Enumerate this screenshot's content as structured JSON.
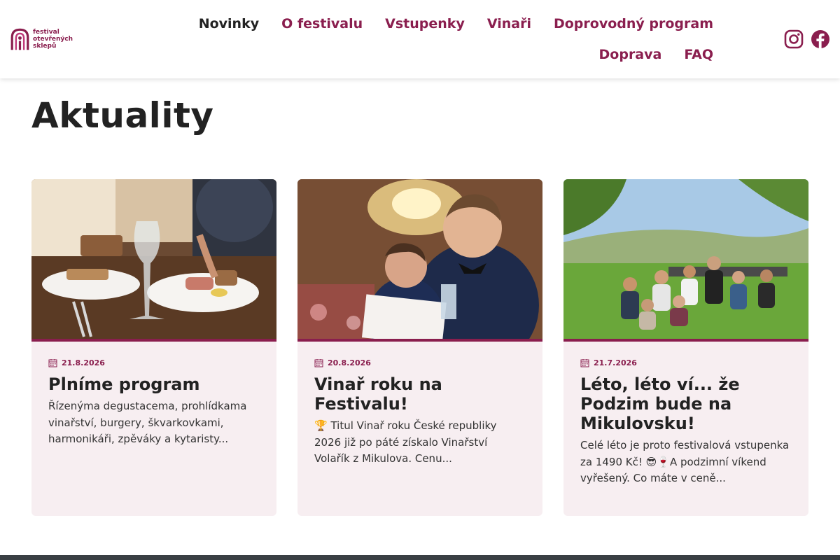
{
  "logo": {
    "line1": "festival",
    "line2": "otevřených",
    "line3": "sklepů"
  },
  "nav": {
    "items": [
      {
        "label": "Novinky"
      },
      {
        "label": "O festivalu"
      },
      {
        "label": "Vstupenky"
      },
      {
        "label": "Vinaři"
      },
      {
        "label": "Doprovodný program"
      },
      {
        "label": "Doprava"
      },
      {
        "label": "FAQ"
      }
    ]
  },
  "social": {
    "instagram": "instagram-icon",
    "facebook": "facebook-icon"
  },
  "colors": {
    "brand": "#8a1e4e",
    "card_bg": "#f7eef1",
    "footer": "#3a3f44"
  },
  "page": {
    "title": "Aktuality"
  },
  "cards": [
    {
      "date": "21.8.2026",
      "title": "Plníme program",
      "excerpt": "Řízenýma degustacema, prohlídkama vinařství, burgery, škvarkovkami, harmonikáři, zpěváky a kytaristy..."
    },
    {
      "date": "20.8.2026",
      "title": "Vinař roku na Festivalu!",
      "excerpt": "🏆 Titul Vinař roku České republiky 2026 již po páté získalo Vinařství Volařík z Mikulova. Cenu..."
    },
    {
      "date": "21.7.2026",
      "title": "Léto, léto ví... že Podzim bude na Mikulovsku!",
      "excerpt": "Celé léto je proto festivalová vstupenka za 1490 Kč! 😎🍷A podzimní víkend vyřešený. Co máte v ceně..."
    }
  ]
}
